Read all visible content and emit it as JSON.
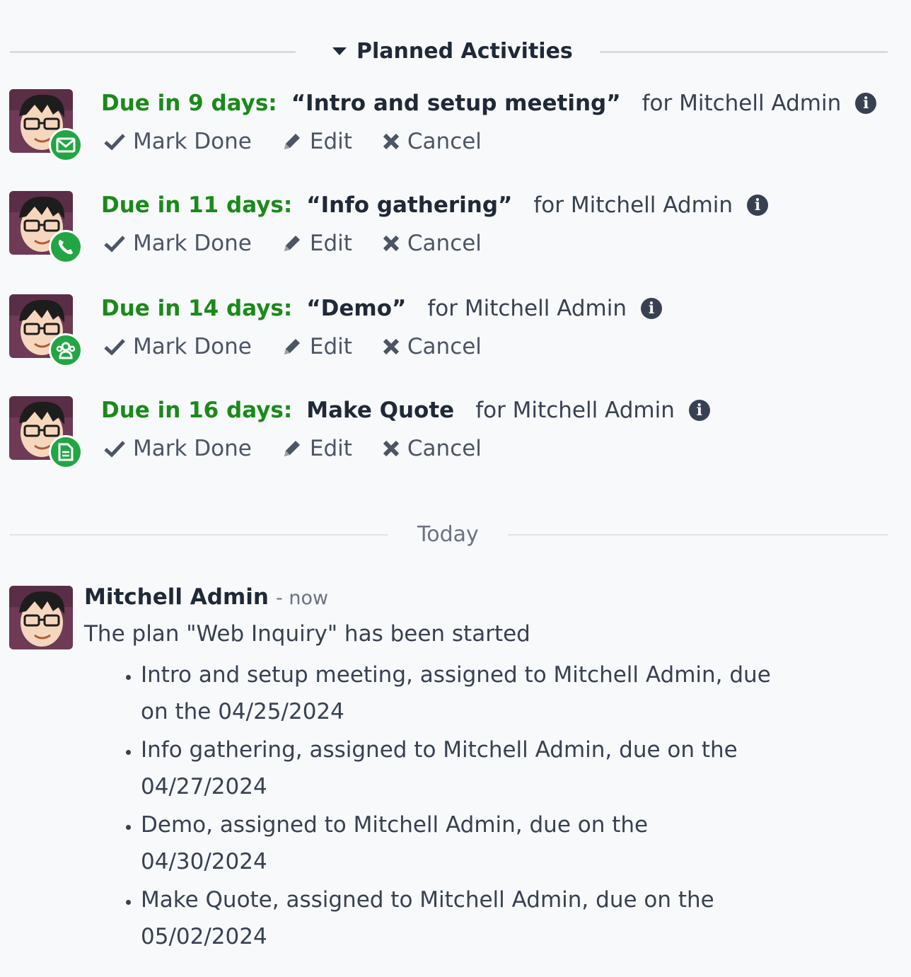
{
  "planned": {
    "title": "Planned Activities",
    "activities": [
      {
        "due": "Due in 9 days:",
        "summary": "“Intro and setup meeting”",
        "assignee": "for Mitchell Admin",
        "type_icon": "envelope-icon"
      },
      {
        "due": "Due in 11 days:",
        "summary": "“Info gathering”",
        "assignee": "for Mitchell Admin",
        "type_icon": "phone-icon"
      },
      {
        "due": "Due in 14 days:",
        "summary": "“Demo”",
        "assignee": "for Mitchell Admin",
        "type_icon": "users-icon"
      },
      {
        "due": "Due in 16 days:",
        "summary": "Make Quote",
        "assignee": "for Mitchell Admin",
        "type_icon": "document-icon"
      }
    ],
    "actions": {
      "mark_done": "Mark Done",
      "edit": "Edit",
      "cancel": "Cancel"
    }
  },
  "today_label": "Today",
  "message": {
    "author": "Mitchell Admin",
    "time": "- now",
    "text": "The plan \"Web Inquiry\" has been started",
    "items": [
      "Intro and setup meeting, assigned to Mitchell Admin, due on the 04/25/2024",
      "Info gathering, assigned to Mitchell Admin, due on the 04/27/2024",
      "Demo, assigned to Mitchell Admin, due on the 04/30/2024",
      "Make Quote, assigned to Mitchell Admin, due on the 05/02/2024"
    ]
  },
  "colors": {
    "due_green": "#1a8a1a",
    "badge_green": "#21a643",
    "avatar_bg": "#6e3a56"
  }
}
